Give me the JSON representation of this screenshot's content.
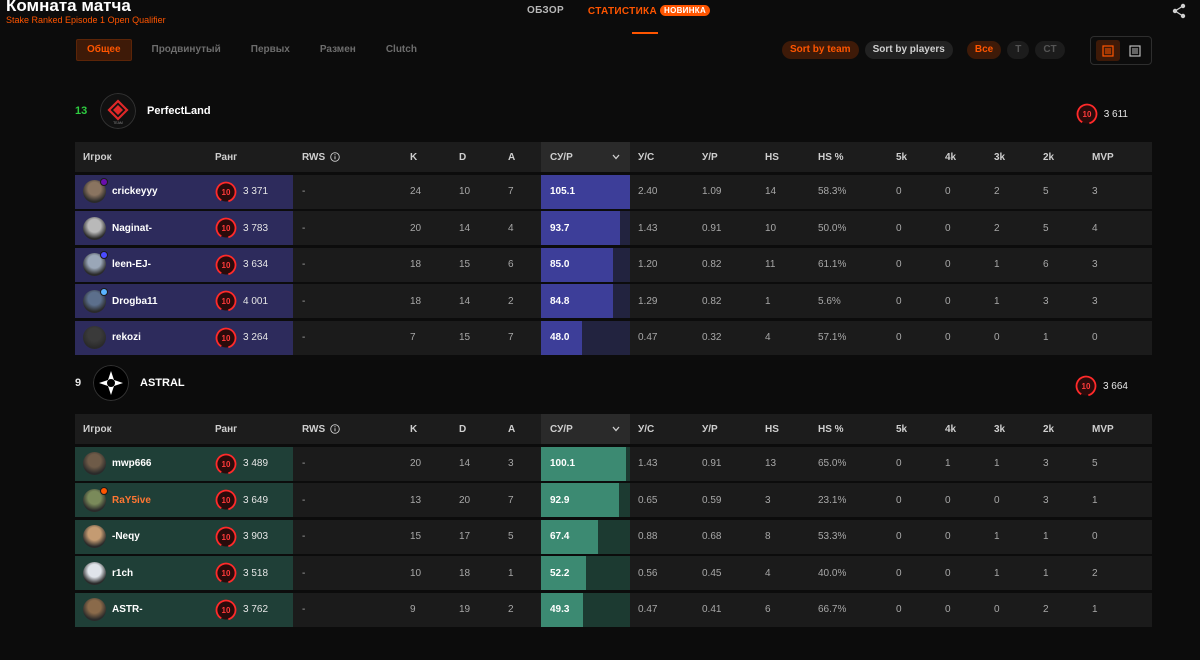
{
  "header": {
    "title": "Комната матча",
    "subtitle": "Stake Ranked Episode 1 Open Qualifier",
    "tabs": [
      {
        "label": "ОБЗОР"
      },
      {
        "label": "СТАТИСТИКА",
        "badge": "НОВИНКА"
      }
    ]
  },
  "subtabs": [
    "Общее",
    "Продвинутый",
    "Первых",
    "Размен",
    "Clutch"
  ],
  "sort": {
    "by_team": "Sort by team",
    "by_players": "Sort by players"
  },
  "side_filter": [
    "Все",
    "T",
    "CT"
  ],
  "columns": {
    "player": "Игрок",
    "rank": "Ранг",
    "rws": "RWS",
    "k": "K",
    "d": "D",
    "a": "A",
    "kr": "СУ/Р",
    "kd": "У/С",
    "kpr": "У/Р",
    "hs": "HS",
    "hsp": "HS %",
    "k5": "5k",
    "k4": "4k",
    "k3": "3k",
    "k2": "2k",
    "mvp": "MVP"
  },
  "colors": {
    "accent": "#ff5500",
    "team_a_row": "#2d2b5c",
    "team_b_row": "#1f3f37",
    "win_score": "#2ecc40"
  },
  "teams": [
    {
      "score": "13",
      "name": "PerfectLand",
      "avg_elo": "3 611",
      "level": "10",
      "players": [
        {
          "nick": "crickeyyy",
          "level": "10",
          "elo": "3 371",
          "rws": "-",
          "k": "24",
          "d": "10",
          "a": "7",
          "kr": "105.1",
          "kr_fraction": 1.0,
          "kd": "2.40",
          "kpr": "1.09",
          "hs": "14",
          "hsp": "58.3%",
          "k5": "0",
          "k4": "0",
          "k3": "2",
          "k2": "5",
          "mvp": "3"
        },
        {
          "nick": "Naginat-",
          "level": "10",
          "elo": "3 783",
          "rws": "-",
          "k": "20",
          "d": "14",
          "a": "4",
          "kr": "93.7",
          "kr_fraction": 0.89,
          "kd": "1.43",
          "kpr": "0.91",
          "hs": "10",
          "hsp": "50.0%",
          "k5": "0",
          "k4": "0",
          "k3": "2",
          "k2": "5",
          "mvp": "4"
        },
        {
          "nick": "leen-EJ-",
          "level": "10",
          "elo": "3 634",
          "rws": "-",
          "k": "18",
          "d": "15",
          "a": "6",
          "kr": "85.0",
          "kr_fraction": 0.81,
          "kd": "1.20",
          "kpr": "0.82",
          "hs": "11",
          "hsp": "61.1%",
          "k5": "0",
          "k4": "0",
          "k3": "1",
          "k2": "6",
          "mvp": "3"
        },
        {
          "nick": "Drogba11",
          "level": "10",
          "elo": "4 001",
          "rws": "-",
          "k": "18",
          "d": "14",
          "a": "2",
          "kr": "84.8",
          "kr_fraction": 0.81,
          "kd": "1.29",
          "kpr": "0.82",
          "hs": "1",
          "hsp": "5.6%",
          "k5": "0",
          "k4": "0",
          "k3": "1",
          "k2": "3",
          "mvp": "3"
        },
        {
          "nick": "rekozi",
          "level": "10",
          "elo": "3 264",
          "rws": "-",
          "k": "7",
          "d": "15",
          "a": "7",
          "kr": "48.0",
          "kr_fraction": 0.46,
          "kd": "0.47",
          "kpr": "0.32",
          "hs": "4",
          "hsp": "57.1%",
          "k5": "0",
          "k4": "0",
          "k3": "0",
          "k2": "1",
          "mvp": "0"
        }
      ]
    },
    {
      "score": "9",
      "name": "ASTRAL",
      "avg_elo": "3 664",
      "level": "10",
      "players": [
        {
          "nick": "mwp666",
          "level": "10",
          "elo": "3 489",
          "rws": "-",
          "k": "20",
          "d": "14",
          "a": "3",
          "kr": "100.1",
          "kr_fraction": 0.95,
          "kd": "1.43",
          "kpr": "0.91",
          "hs": "13",
          "hsp": "65.0%",
          "k5": "0",
          "k4": "1",
          "k3": "1",
          "k2": "3",
          "mvp": "5"
        },
        {
          "nick": "RaY5ive",
          "level": "10",
          "elo": "3 649",
          "rws": "-",
          "k": "13",
          "d": "20",
          "a": "7",
          "kr": "92.9",
          "kr_fraction": 0.88,
          "kd": "0.65",
          "kpr": "0.59",
          "hs": "3",
          "hsp": "23.1%",
          "k5": "0",
          "k4": "0",
          "k3": "0",
          "k2": "3",
          "mvp": "1"
        },
        {
          "nick": "-Neqy",
          "level": "10",
          "elo": "3 903",
          "rws": "-",
          "k": "15",
          "d": "17",
          "a": "5",
          "kr": "67.4",
          "kr_fraction": 0.64,
          "kd": "0.88",
          "kpr": "0.68",
          "hs": "8",
          "hsp": "53.3%",
          "k5": "0",
          "k4": "0",
          "k3": "1",
          "k2": "1",
          "mvp": "0"
        },
        {
          "nick": "r1ch",
          "level": "10",
          "elo": "3 518",
          "rws": "-",
          "k": "10",
          "d": "18",
          "a": "1",
          "kr": "52.2",
          "kr_fraction": 0.5,
          "kd": "0.56",
          "kpr": "0.45",
          "hs": "4",
          "hsp": "40.0%",
          "k5": "0",
          "k4": "0",
          "k3": "1",
          "k2": "1",
          "mvp": "2"
        },
        {
          "nick": "ASTR-",
          "level": "10",
          "elo": "3 762",
          "rws": "-",
          "k": "9",
          "d": "19",
          "a": "2",
          "kr": "49.3",
          "kr_fraction": 0.47,
          "kd": "0.47",
          "kpr": "0.41",
          "hs": "6",
          "hsp": "66.7%",
          "k5": "0",
          "k4": "0",
          "k3": "0",
          "k2": "2",
          "mvp": "1"
        }
      ]
    }
  ]
}
